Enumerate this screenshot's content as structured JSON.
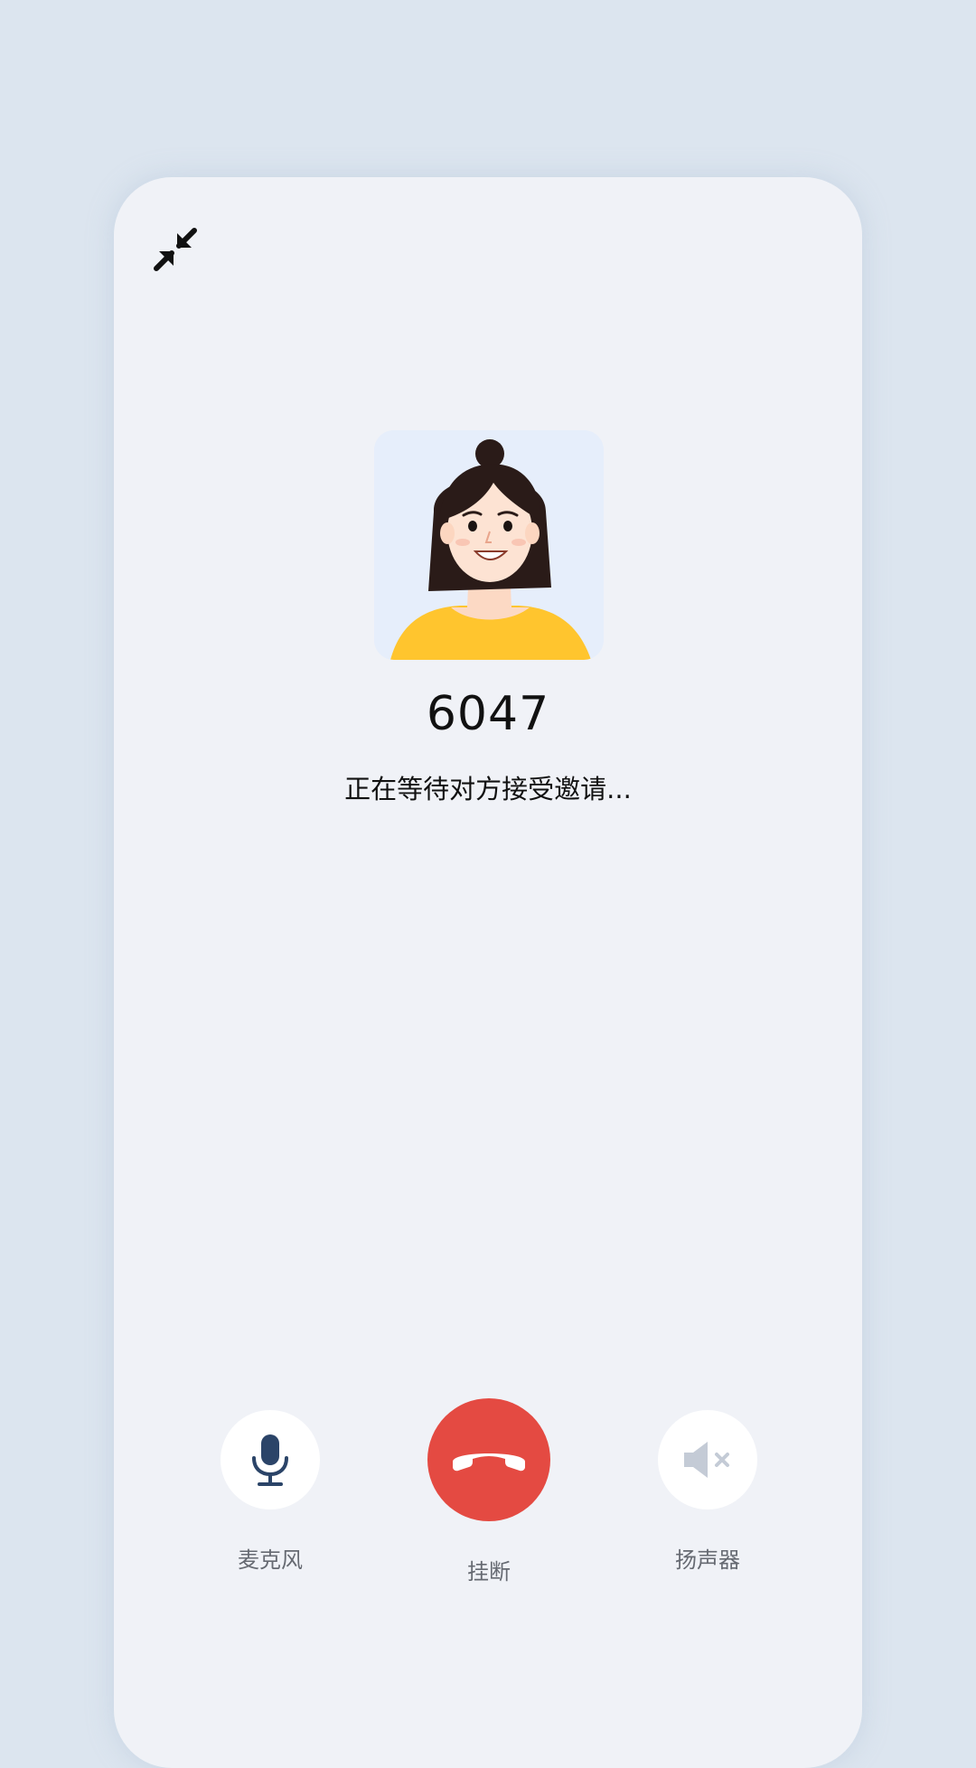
{
  "call": {
    "caller_name": "6047",
    "status": "正在等待对方接受邀请..."
  },
  "icons": {
    "minimize": "minimize-arrows-icon",
    "avatar": "woman-avatar-illustration",
    "microphone": "microphone-icon",
    "hangup": "phone-hangup-icon",
    "speaker": "speaker-muted-icon"
  },
  "controls": {
    "microphone_label": "麦克风",
    "hangup_label": "挂断",
    "speaker_label": "扬声器"
  },
  "colors": {
    "page_background": "#dce5ef",
    "card_background": "#f0f2f7",
    "hangup": "#e44a42",
    "microphone_icon": "#2b4468",
    "speaker_icon_disabled": "#c4cbd6",
    "avatar_shirt": "#ffc52e"
  }
}
